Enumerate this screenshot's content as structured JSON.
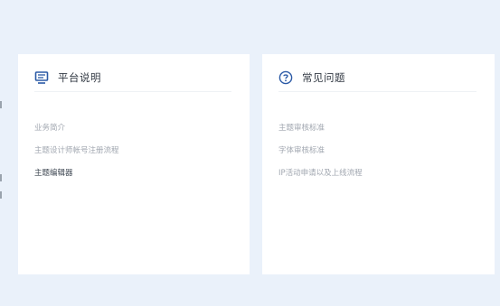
{
  "platform_card": {
    "title": "平台说明",
    "icon": "monitor-icon",
    "links": [
      {
        "label": "业务简介",
        "active": false
      },
      {
        "label": "主题设计师帐号注册流程",
        "active": false
      },
      {
        "label": "主题编辑器",
        "active": true
      }
    ]
  },
  "faq_card": {
    "title": "常见问题",
    "icon": "question-circle-icon",
    "links": [
      {
        "label": "主题审核标准"
      },
      {
        "label": "字体审核标准"
      },
      {
        "label": "IP活动申请以及上线流程"
      }
    ]
  },
  "colors": {
    "background": "#eaf1fa",
    "card": "#ffffff",
    "accent": "#2b5aa6",
    "link_muted": "#a1a7b0",
    "link_active": "#3c4550"
  }
}
